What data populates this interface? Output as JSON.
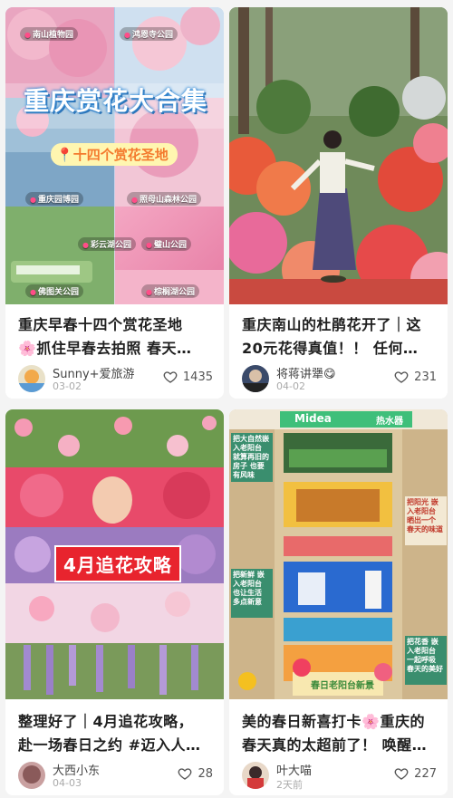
{
  "cards": [
    {
      "cover_headline": "重庆赏花大合集",
      "cover_sub": "十四个赏花圣地",
      "cover_tags": [
        "南山植物园",
        "鸿恩寺公园",
        "重庆园博园",
        "照母山森林公园",
        "彩云湖公园",
        "璧山公园",
        "佛图关公园",
        "棕榈湖公园"
      ],
      "title_line1": "重庆早春十四个赏花圣地",
      "title_line2_emoji": "🌸",
      "title_line2": "抓住早春去拍照 春天…",
      "author": "Sunny+爱旅游",
      "date": "03-02",
      "likes": "1435"
    },
    {
      "title_line1": "重庆南山的杜鹃花开了｜这",
      "title_line2": "20元花得真值！！ 任何…",
      "author": "将蒋讲犟😋",
      "date": "04-02",
      "likes": "231"
    },
    {
      "cover_banner": "4月追花攻略",
      "title_line1": "整理好了｜4月追花攻略，",
      "title_line2": "赴一场春日之约 #迈入人…",
      "author": "大西小东",
      "date": "04-03",
      "likes": "28"
    },
    {
      "cover_brand": "Midea",
      "cover_brand2": "热水器",
      "cover_signs": [
        "把大自然嵌入老阳台 就算再旧的房子 也要有风味",
        "把新鲜 嵌入老阳台 也让生活 多点新意",
        "把阳光 嵌入老阳台 晒出一个 春天的味道",
        "把花香 嵌入老阳台 一起呼吸 春天的美好"
      ],
      "cover_footer": "春日老阳台新景",
      "title_line1": "美的春日新喜打卡",
      "title_line1_emoji": "🌸",
      "title_line1_end": "重庆的",
      "title_line2": "春天真的太超前了！ 唤醒…",
      "author": "叶大喵",
      "date": "2天前",
      "likes": "227"
    }
  ]
}
